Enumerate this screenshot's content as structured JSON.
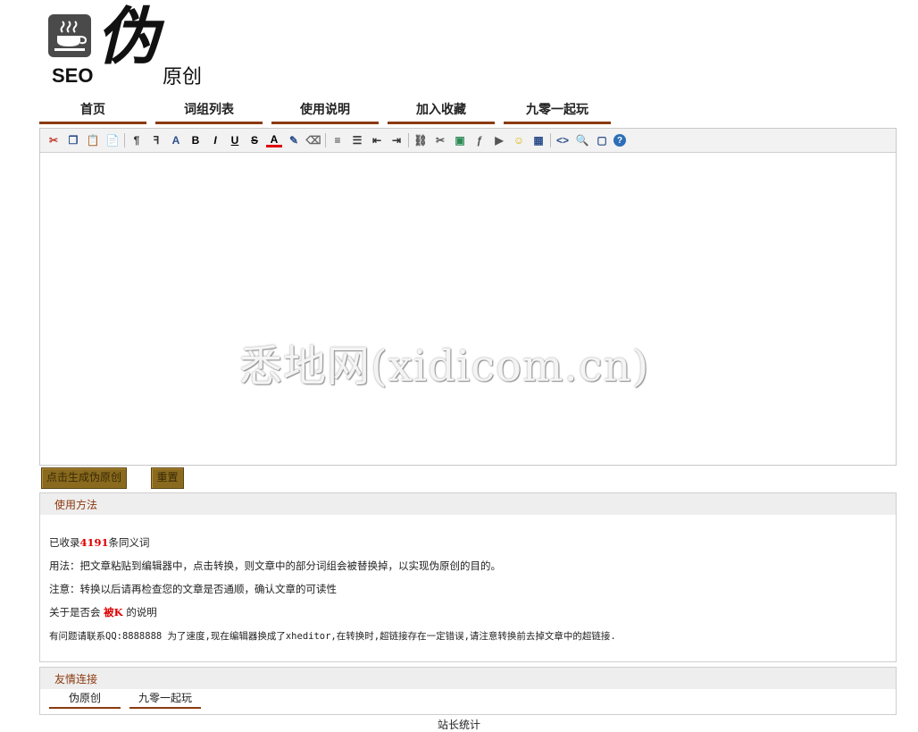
{
  "logo": {
    "seo": "SEO",
    "big": "伪",
    "small": "原创"
  },
  "nav": [
    "首页",
    "词组列表",
    "使用说明",
    "加入收藏",
    "九零一起玩"
  ],
  "toolbar": [
    "cut-icon",
    "copy-icon",
    "paste-icon",
    "paste-text-icon",
    "sep",
    "block-icon",
    "font-family-icon",
    "font-size-icon",
    "bold-icon",
    "italic-icon",
    "underline-icon",
    "strikethrough-icon",
    "font-color-icon",
    "background-color-icon",
    "remove-format-icon",
    "sep",
    "align-icon",
    "list-icon",
    "outdent-icon",
    "indent-icon",
    "sep",
    "link-icon",
    "unlink-icon",
    "image-icon",
    "flash-icon",
    "media-icon",
    "emoticon-icon",
    "table-icon",
    "sep",
    "source-icon",
    "preview-icon",
    "fullscreen-icon",
    "about-icon"
  ],
  "watermark": "悉地网(xidicom.cn)",
  "buttons": {
    "generate": "点击生成伪原创",
    "reset": "重置"
  },
  "usage": {
    "title": "使用方法",
    "count_prefix": "已收录",
    "count": "4191",
    "count_suffix": "条同义词",
    "line1": "用法：把文章粘贴到编辑器中，点击转换，则文章中的部分词组会被替换掉，以实现伪原创的目的。",
    "line2": "注意：转换以后请再检查您的文章是否通顺，确认文章的可读性",
    "line3_prefix": "关于是否会",
    "line3_red": "被K",
    "line3_suffix": "的说明",
    "line4": "有问题请联系QQ:8888888 为了速度,现在编辑器换成了xheditor,在转换时,超链接存在一定错误,请注意转换前去掉文章中的超链接."
  },
  "friends": {
    "title": "友情连接",
    "links": [
      "伪原创",
      "九零一起玩"
    ]
  },
  "footer": "站长统计"
}
